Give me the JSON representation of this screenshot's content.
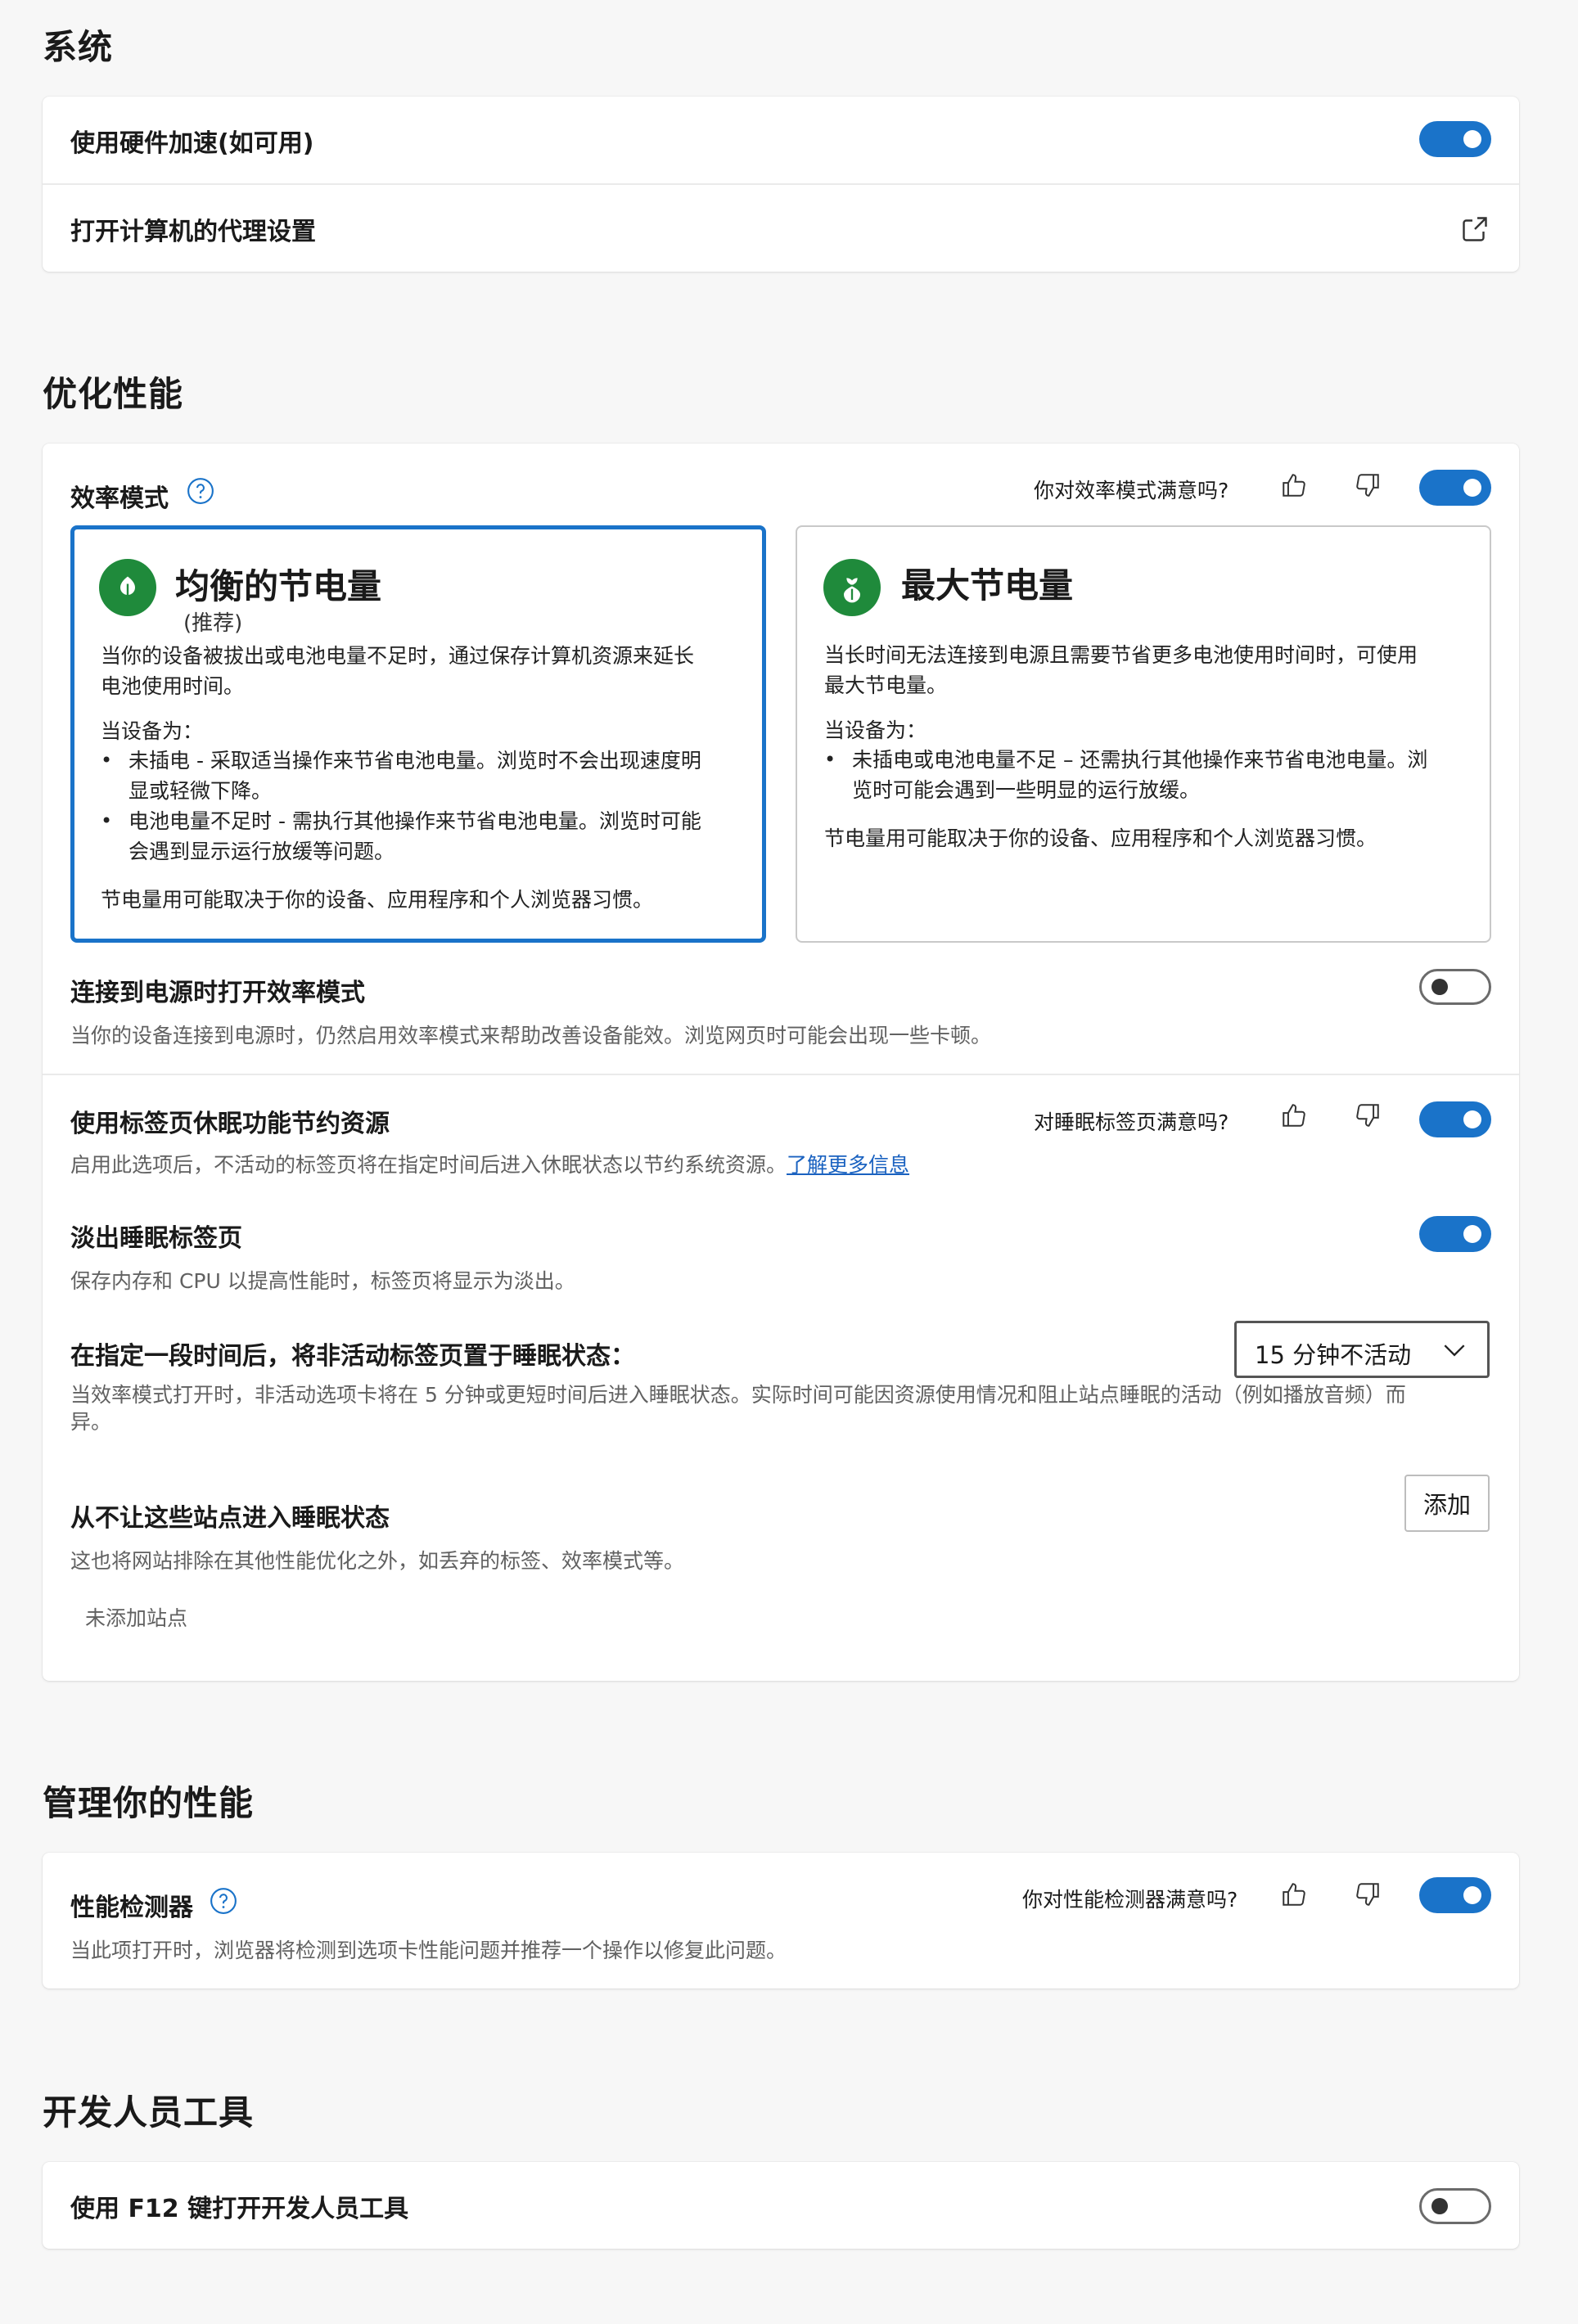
{
  "system": {
    "title": "系统",
    "hardware_accel_label": "使用硬件加速(如可用)",
    "hardware_accel_on": true,
    "proxy_label": "打开计算机的代理设置"
  },
  "performance": {
    "title": "优化性能",
    "efficiency_label": "效率模式",
    "efficiency_feedback": "你对效率模式满意吗?",
    "efficiency_on": true,
    "balanced": {
      "title": "均衡的节电量",
      "subtitle": "(推荐)",
      "intro_line1": "当你的设备被拔出或电池电量不足时，通过保存计算机资源来延长",
      "intro_line2": "电池使用时间。",
      "when_label": "当设备为：",
      "bullet1_line1": "未插电 - 采取适当操作来节省电池电量。浏览时不会出现速度明",
      "bullet1_line2": "显或轻微下降。",
      "bullet2_line1": "电池电量不足时 - 需执行其他操作来节省电池电量。浏览时可能",
      "bullet2_line2": "会遇到显示运行放缓等问题。",
      "footer": "节电量用可能取决于你的设备、应用程序和个人浏览器习惯。"
    },
    "maximum": {
      "title": "最大节电量",
      "intro_line1": "当长时间无法连接到电源且需要节省更多电池使用时间时，可使用",
      "intro_line2": "最大节电量。",
      "when_label": "当设备为：",
      "bullet1_line1": "未插电或电池电量不足 – 还需执行其他操作来节省电池电量。浏",
      "bullet1_line2": "览时可能会遇到一些明显的运行放缓。",
      "footer": "节电量用可能取决于你的设备、应用程序和个人浏览器习惯。"
    },
    "plugged_label": "连接到电源时打开效率模式",
    "plugged_desc": "当你的设备连接到电源时，仍然启用效率模式来帮助改善设备能效。浏览网页时可能会出现一些卡顿。",
    "plugged_on": false,
    "sleeping_label": "使用标签页休眠功能节约资源",
    "sleeping_feedback": "对睡眠标签页满意吗?",
    "sleeping_desc": "启用此选项后，不活动的标签页将在指定时间后进入休眠状态以节约系统资源。",
    "learn_more": "了解更多信息",
    "sleeping_on": true,
    "fade_label": "淡出睡眠标签页",
    "fade_desc": "保存内存和 CPU 以提高性能时，标签页将显示为淡出。",
    "fade_on": true,
    "timeout_label": "在指定一段时间后，将非活动标签页置于睡眠状态：",
    "timeout_value": "15 分钟不活动",
    "timeout_desc_line1": "当效率模式打开时，非活动选项卡将在 5 分钟或更短时间后进入睡眠状态。实际时间可能因资源使用情况和阻止站点睡眠的活动（例如播放音频）而",
    "timeout_desc_line2": "异。",
    "never_label": "从不让这些站点进入睡眠状态",
    "never_desc": "这也将网站排除在其他性能优化之外，如丢弃的标签、效率模式等。",
    "add_button": "添加",
    "no_sites": "未添加站点"
  },
  "manage": {
    "title": "管理你的性能",
    "monitor_label": "性能检测器",
    "monitor_feedback": "你对性能检测器满意吗?",
    "monitor_desc": "当此项打开时，浏览器将检测到选项卡性能问题并推荐一个操作以修复此问题。",
    "monitor_on": true
  },
  "devtools": {
    "title": "开发人员工具",
    "f12_label": "使用 F12 键打开开发人员工具",
    "f12_on": false
  },
  "icons": [
    "external-link-icon",
    "help-icon",
    "thumbs-up-icon",
    "thumbs-down-icon",
    "leaf-icon",
    "chevron-down-icon"
  ],
  "colors": {
    "accent": "#1a73c9",
    "leaf_green": "#1f8a3b",
    "link": "#1a62c0"
  }
}
